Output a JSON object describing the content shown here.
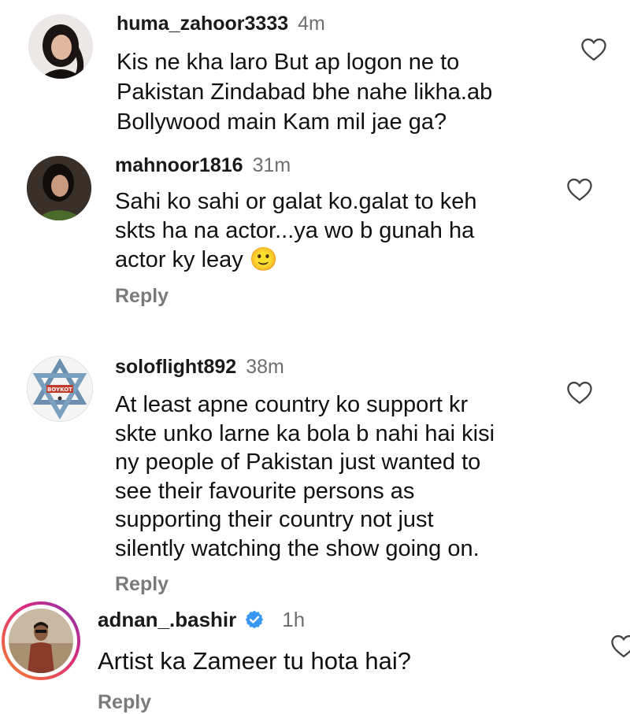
{
  "comments": [
    {
      "username": "huma_zahoor3333",
      "time": "4m",
      "lines": [
        "Kis ne kha laro But ap logon ne to",
        "Pakistan Zindabad bhe nahe likha.ab",
        "Bollywood main Kam mil jae ga?"
      ],
      "has_reply": false
    },
    {
      "username": "mahnoor1816",
      "time": "31m",
      "lines": [
        "Sahi ko sahi or galat ko.galat to keh",
        "skts ha na actor...ya wo b gunah ha",
        "actor ky leay"
      ],
      "emoji": "🙂",
      "reply_label": "Reply"
    },
    {
      "username": "soloflight892",
      "time": "38m",
      "avatar_text": "BOYKOT",
      "lines": [
        "At least apne country ko support kr",
        "skte unko larne ka bola b nahi hai kisi",
        "ny people of Pakistan just wanted to",
        "see their favourite persons as",
        "supporting their country not just",
        "silently watching the show going on."
      ],
      "reply_label": "Reply"
    },
    {
      "username": "adnan_.bashir",
      "time": "1h",
      "verified": true,
      "lines": [
        "Artist ka Zameer tu hota hai?"
      ],
      "reply_label": "Reply"
    }
  ],
  "colors": {
    "username": "#1a1a1a",
    "time": "#6f6f6f",
    "reply": "#7a7a7a",
    "verified": "#3897f0",
    "story_ring_start": "#f58529",
    "story_ring_end": "#dd2a7b"
  }
}
